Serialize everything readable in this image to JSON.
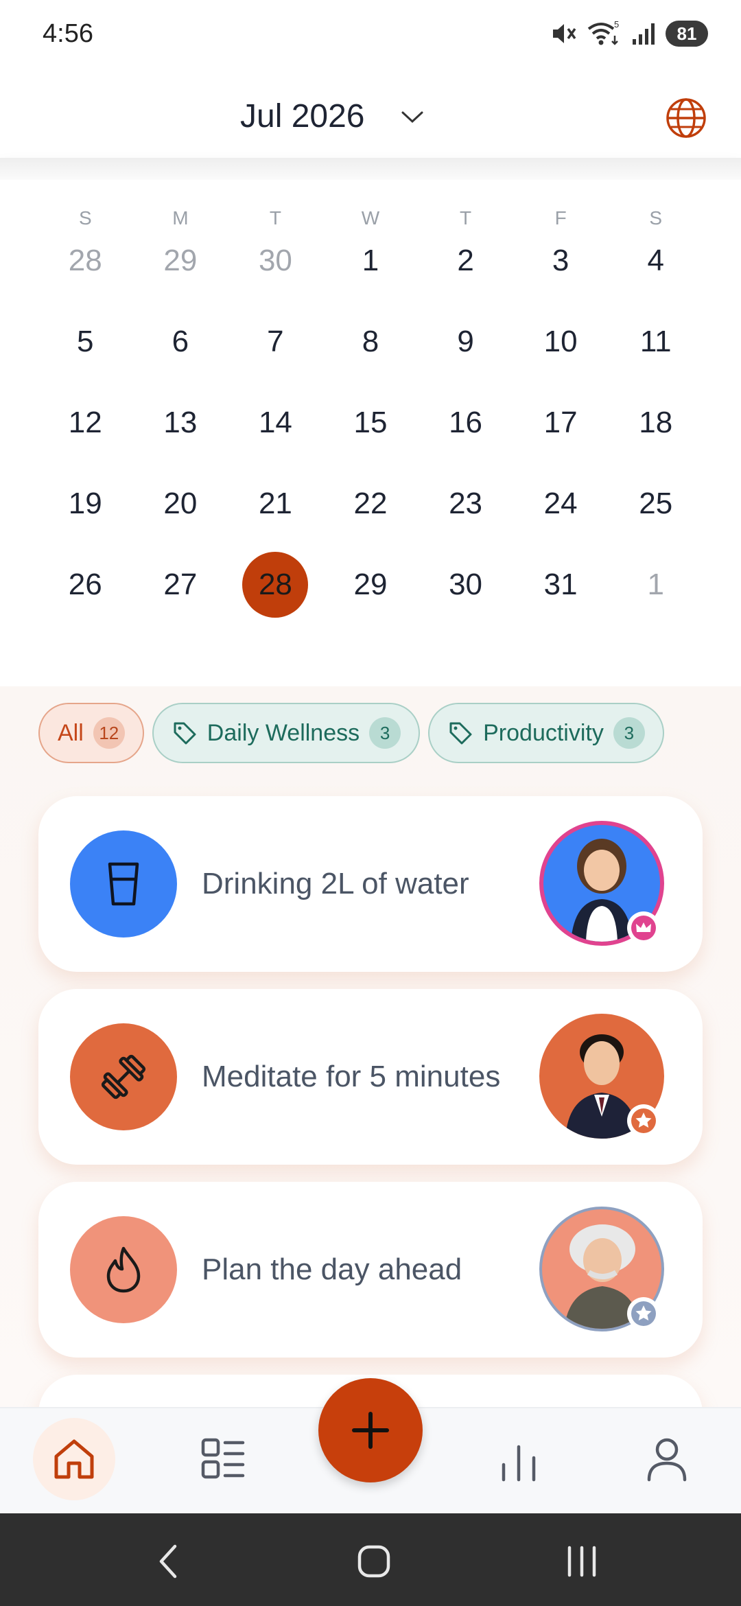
{
  "status_bar": {
    "time": "4:56",
    "battery": "81",
    "wifi_badge": "5",
    "icons": [
      "mute-icon",
      "wifi-icon",
      "signal-icon",
      "battery-icon"
    ]
  },
  "header": {
    "month": "Jul 2026",
    "icons": [
      "chevron-down-icon",
      "globe-icon"
    ],
    "accent_color": "#c03e0b"
  },
  "calendar": {
    "weekdays": [
      "S",
      "M",
      "T",
      "W",
      "T",
      "F",
      "S"
    ],
    "weeks": [
      [
        {
          "d": "28",
          "muted": true
        },
        {
          "d": "29",
          "muted": true
        },
        {
          "d": "30",
          "muted": true
        },
        {
          "d": "1"
        },
        {
          "d": "2"
        },
        {
          "d": "3"
        },
        {
          "d": "4"
        }
      ],
      [
        {
          "d": "5"
        },
        {
          "d": "6"
        },
        {
          "d": "7"
        },
        {
          "d": "8"
        },
        {
          "d": "9"
        },
        {
          "d": "10"
        },
        {
          "d": "11"
        }
      ],
      [
        {
          "d": "12"
        },
        {
          "d": "13"
        },
        {
          "d": "14"
        },
        {
          "d": "15"
        },
        {
          "d": "16"
        },
        {
          "d": "17"
        },
        {
          "d": "18"
        }
      ],
      [
        {
          "d": "19"
        },
        {
          "d": "20"
        },
        {
          "d": "21"
        },
        {
          "d": "22"
        },
        {
          "d": "23"
        },
        {
          "d": "24"
        },
        {
          "d": "25"
        }
      ],
      [
        {
          "d": "26"
        },
        {
          "d": "27"
        },
        {
          "d": "28",
          "selected": true
        },
        {
          "d": "29"
        },
        {
          "d": "30"
        },
        {
          "d": "31"
        },
        {
          "d": "1",
          "muted": true
        }
      ]
    ]
  },
  "filters": [
    {
      "label": "All",
      "count": "12",
      "style": "all",
      "icon": null
    },
    {
      "label": "Daily Wellness",
      "count": "3",
      "style": "teal",
      "icon": "tag-icon"
    },
    {
      "label": "Productivity",
      "count": "3",
      "style": "teal",
      "icon": "tag-icon"
    }
  ],
  "habits": [
    {
      "label": "Drinking 2L of water",
      "icon": "water-glass-icon",
      "icon_bg": "#3b82f6",
      "avatar": "maid-avatar",
      "avatar_bg": "#3b82f6",
      "avatar_ring": "#e0438f",
      "badge": "crown-icon",
      "badge_color": "#e0438f"
    },
    {
      "label": "Meditate for 5 minutes",
      "icon": "dumbbell-icon",
      "icon_bg": "#e06a3e",
      "avatar": "gentleman-avatar",
      "avatar_bg": "#e06a3e",
      "avatar_ring": "#e06a3e",
      "badge": "star-icon",
      "badge_color": "#e06a3e"
    },
    {
      "label": "Plan the day ahead",
      "icon": "flame-icon",
      "icon_bg": "#f0937a",
      "avatar": "scientist-avatar",
      "avatar_bg": "#f0937a",
      "avatar_ring": "#8ea0c0",
      "badge": "star-icon",
      "badge_color": "#8ea0c0"
    }
  ],
  "bottom_nav": {
    "items": [
      "home-icon",
      "list-icon",
      "stats-icon",
      "profile-icon"
    ],
    "active": "home-icon",
    "fab_icon": "plus-icon"
  },
  "system_nav": [
    "back-icon",
    "home-button-icon",
    "recents-icon"
  ]
}
